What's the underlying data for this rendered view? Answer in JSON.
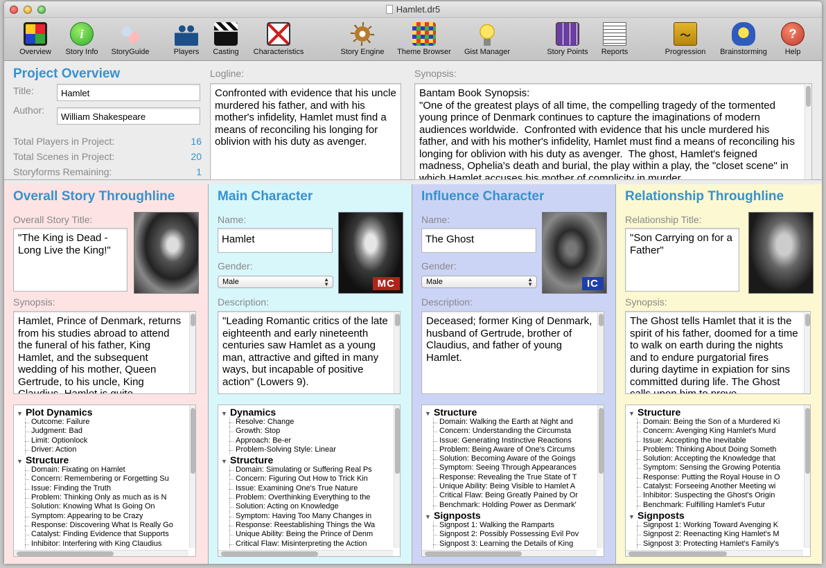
{
  "window": {
    "title": "Hamlet.dr5"
  },
  "toolbar": [
    {
      "label": "Overview",
      "icon": "overview-icon"
    },
    {
      "label": "Story Info",
      "icon": "info-icon"
    },
    {
      "label": "StoryGuide",
      "icon": "storyguide-icon"
    },
    {
      "label": "Players",
      "icon": "players-icon"
    },
    {
      "label": "Casting",
      "icon": "clapperboard-icon"
    },
    {
      "label": "Characteristics",
      "icon": "characteristics-icon"
    },
    {
      "label": "Story Engine",
      "icon": "ship-wheel-icon"
    },
    {
      "label": "Theme Browser",
      "icon": "theme-grid-icon"
    },
    {
      "label": "Gist Manager",
      "icon": "lightbulb-icon"
    },
    {
      "label": "Story Points",
      "icon": "story-points-icon"
    },
    {
      "label": "Reports",
      "icon": "report-icon"
    },
    {
      "label": "Progression",
      "icon": "progression-icon"
    },
    {
      "label": "Brainstorming",
      "icon": "brainstorm-icon"
    },
    {
      "label": "Help",
      "icon": "help-icon"
    }
  ],
  "overview": {
    "heading": "Project Overview",
    "title_label": "Title:",
    "title_value": "Hamlet",
    "author_label": "Author:",
    "author_value": "William Shakespeare",
    "stats": [
      {
        "label": "Total Players in Project:",
        "value": "16"
      },
      {
        "label": "Total Scenes in Project:",
        "value": "20"
      },
      {
        "label": "Storyforms Remaining:",
        "value": "1"
      }
    ],
    "logline_label": "Logline:",
    "logline": "Confronted with evidence that his uncle murdered his father, and with his mother's infidelity, Hamlet must find a means of reconciling his longing for oblivion with his duty as avenger.",
    "synopsis_label": "Synopsis:",
    "synopsis": "Bantam Book Synopsis:\n\"One of the greatest plays of all time, the compelling tragedy of the tormented young prince of Denmark continues to capture the imaginations of modern audiences worldwide.  Confronted with evidence that his uncle murdered his father, and with his mother's infidelity, Hamlet must find a means of reconciling his longing for oblivion with his duty as avenger.  The ghost, Hamlet's feigned madness, Ophelia's death and burial, the play within a play, the \"closet scene\" in which Hamlet accuses his mother of complicity in murder"
  },
  "panels": {
    "os": {
      "bg": "#fde3e3",
      "heading": "Overall Story Throughline",
      "title_label": "Overall Story Title:",
      "title_value": "\"The King is Dead - Long Live the King!\"",
      "desc_label": "Synopsis:",
      "desc": "Hamlet, Prince of Denmark, returns from his studies abroad to attend the funeral of his father, King Hamlet, and the subsequent wedding of his mother, Queen Gertrude, to his uncle, King Claudius.  Hamlet is quite",
      "tree": [
        {
          "group": "Plot Dynamics",
          "rows": [
            "Outcome:  Failure",
            "Judgment:  Bad",
            "Limit:  Optionlock",
            "Driver:  Action"
          ]
        },
        {
          "group": "Structure",
          "rows": [
            "Domain:  Fixating on Hamlet",
            "Concern:  Remembering or Forgetting Su",
            "Issue:  Finding the Truth",
            "Problem:  Thinking Only as much as is N",
            "Solution:  Knowing What Is Going On",
            "Symptom:  Appearing to be Crazy",
            "Response:  Discovering What Is Really Go",
            "Catalyst:  Finding Evidence that Supports",
            "Inhibitor:  Interfering with King Claudius"
          ]
        }
      ]
    },
    "mc": {
      "bg": "#d7f7fb",
      "heading": "Main Character",
      "name_label": "Name:",
      "name_value": "Hamlet",
      "gender_label": "Gender:",
      "gender_value": "Male",
      "badge": "MC",
      "badge_color": "#b0241c",
      "desc_label": "Description:",
      "desc": "\"Leading Romantic critics of the late eighteenth and early nineteenth centuries saw Hamlet as a young man, attractive and gifted in many ways, but incapable of positive action\" (Lowers 9).",
      "tree": [
        {
          "group": "Dynamics",
          "rows": [
            "Resolve:  Change",
            "Growth:  Stop",
            "Approach:  Be-er",
            "Problem-Solving Style:  Linear"
          ]
        },
        {
          "group": "Structure",
          "rows": [
            "Domain:  Simulating or Suffering Real Ps",
            "Concern:  Figuring Out How to Trick Kin",
            "Issue:  Examining One's True Nature",
            "Problem:  Overthinking Everything to the",
            "Solution:  Acting on Knowledge",
            "Symptom:  Having Too Many Changes in",
            "Response:  Reestablishing Things the Wa",
            "Unique Ability:  Being the Prince of Denm",
            "Critical Flaw:  Misinterpreting the Action"
          ]
        }
      ]
    },
    "ic": {
      "bg": "#ccd4f6",
      "heading": "Influence Character",
      "name_label": "Name:",
      "name_value": "The Ghost",
      "gender_label": "Gender:",
      "gender_value": "Male",
      "badge": "IC",
      "badge_color": "#1f3fa8",
      "desc_label": "Description:",
      "desc": "Deceased; former King of Denmark, husband of Gertrude, brother of Claudius, and father of young Hamlet.",
      "tree": [
        {
          "group": "Structure",
          "rows": [
            "Domain:  Walking the Earth at Night and",
            "Concern:  Understanding the Circumsta",
            "Issue:  Generating Instinctive Reactions",
            "Problem:  Being Aware of One's Circums",
            "Solution:  Becoming Aware of the Goings",
            "Symptom:  Seeing Through Appearances",
            "Response:  Revealing the True State of T",
            "Unique Ability:  Being Visible to Hamlet A",
            "Critical Flaw:  Being Greatly Pained by Or",
            "Benchmark:  Holding Power as Denmark'"
          ]
        },
        {
          "group": "Signposts",
          "rows": [
            "Signpost 1:  Walking the Ramparts",
            "Signpost 2:  Possibly Possessing Evil Pov",
            "Signpost 3:  Learning the Details of King"
          ]
        }
      ]
    },
    "rs": {
      "bg": "#fbf8d2",
      "heading": "Relationship Throughline",
      "title_label": "Relationship Title:",
      "title_value": "\"Son Carrying on for a Father\"",
      "desc_label": "Synopsis:",
      "desc": "The Ghost tells Hamlet that it is the spirit of his father, doomed for a time to walk on earth during the nights and to endure purgatorial fires during daytime in expiation for sins committed during life.  The Ghost calls upon him to prove",
      "tree": [
        {
          "group": "Structure",
          "rows": [
            "Domain:  Being the Son of a Murdered Ki",
            "Concern:  Avenging King Hamlet's Murd",
            "Issue:  Accepting the Inevitable",
            "Problem:  Thinking About Doing Someth",
            "Solution:  Accepting the Knowledge that",
            "Symptom:  Sensing the Growing Potentia",
            "Response:  Putting the Royal House in O",
            "Catalyst:  Forseeing Another Meeting wi",
            "Inhibitor:  Suspecting the Ghost's Origin",
            "Benchmark:  Fulfilling Hamlet's Futur"
          ]
        },
        {
          "group": "Signposts",
          "rows": [
            "Signpost 1:  Working Toward Avenging K",
            "Signpost 2:  Reenacting King Hamlet's M",
            "Signpost 3:  Protecting Hamlet's Family's"
          ]
        }
      ]
    }
  }
}
